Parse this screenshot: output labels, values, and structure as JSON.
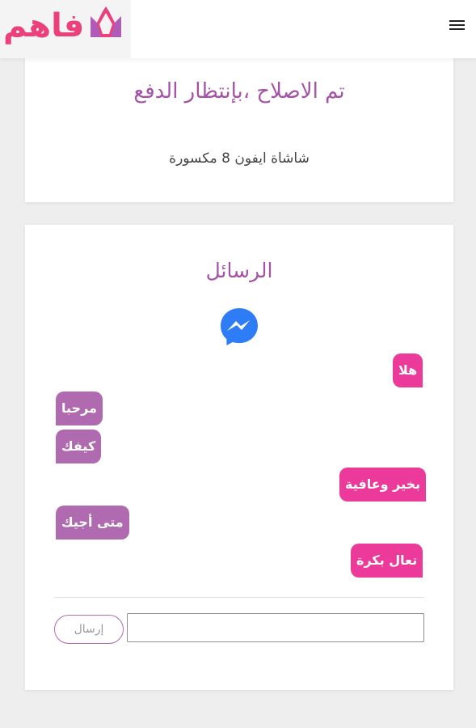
{
  "header": {
    "logo_text": "فاهم",
    "brand_color": "#ec407a"
  },
  "status_card": {
    "title": "تم الاصلاح ،بإنتظار الدفع",
    "subtitle": "شاشاة ايفون 8 مكسورة"
  },
  "messages_card": {
    "title": "الرسائل",
    "icon": "messenger-icon",
    "messages": [
      {
        "text": "هلا",
        "side": "right"
      },
      {
        "text": "مرحبا",
        "side": "left"
      },
      {
        "text": "كيفك",
        "side": "left"
      },
      {
        "text": "بخير وعافية",
        "side": "right"
      },
      {
        "text": "متى أجيك",
        "side": "left"
      },
      {
        "text": "تعال بكرة",
        "side": "right"
      }
    ],
    "input_value": "",
    "send_label": "إرسال"
  },
  "colors": {
    "accent_purple": "#a453a6",
    "bubble_right": "#ec3a9a",
    "bubble_left": "#b06bb0",
    "messenger_blue": "#2f7df6"
  }
}
